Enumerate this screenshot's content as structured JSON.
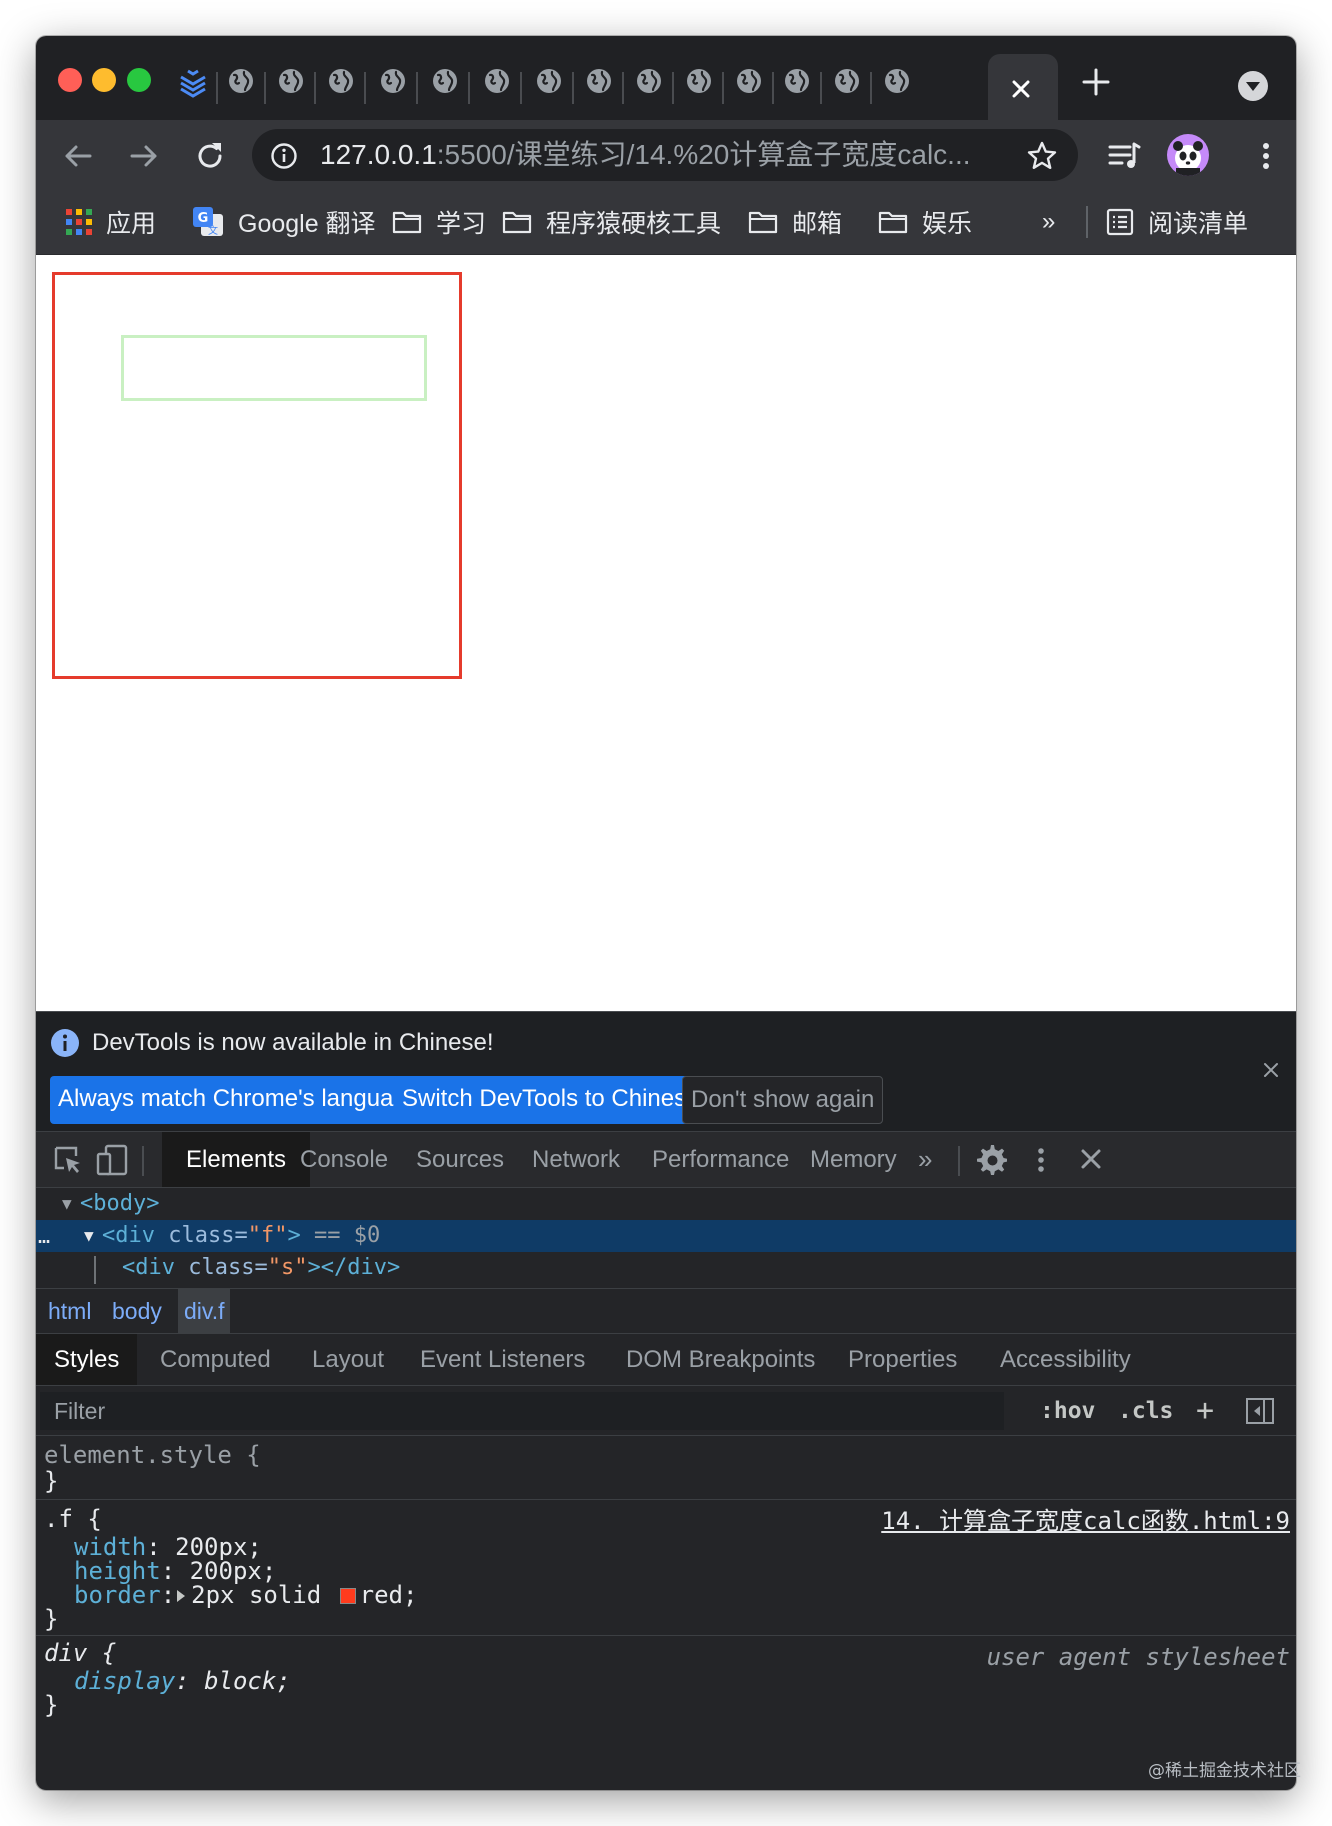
{
  "browser": {
    "active_tab_close_icon": "close-icon",
    "new_tab_icon": "plus-icon",
    "tab_search_icon": "chevron-down-circle-icon",
    "tab_favicon": "globe-icon",
    "first_tab_favicon": "layered-chevrons-icon",
    "url_host": "127.0.0.1",
    "url_path": ":5500/课堂练习/14.%20计算盒子宽度calc...",
    "nav": {
      "back_icon": "arrow-left-icon",
      "forward_icon": "arrow-right-icon",
      "reload_icon": "reload-icon",
      "site_info_icon": "info-circle-icon",
      "bookmark_icon": "star-icon",
      "reading_list_icon": "media-queue-icon",
      "profile_icon": "panda-avatar",
      "menu_icon": "kebab-menu-icon"
    },
    "bookmarks": [
      {
        "label": "应用",
        "icon": "apps-grid-icon"
      },
      {
        "label": "Google 翻译",
        "icon": "google-translate-icon"
      },
      {
        "label": "学习",
        "icon": "folder-icon"
      },
      {
        "label": "程序猿硬核工具",
        "icon": "folder-icon"
      },
      {
        "label": "邮箱",
        "icon": "folder-icon"
      },
      {
        "label": "娱乐",
        "icon": "folder-icon"
      }
    ],
    "bookmarks_overflow": "»",
    "reading_list_label": "阅读清单",
    "traffic_lights": {
      "close": "#ff5f57",
      "minimize": "#febc2e",
      "zoom": "#28c840"
    }
  },
  "page": {
    "outer_box_color": "#e53b2c",
    "inner_box_color": "#c9f0c2"
  },
  "devtools": {
    "infobar": {
      "message": "DevTools is now available in Chinese!",
      "btn_match": "Always match Chrome's language",
      "btn_switch": "Switch DevTools to Chinese",
      "btn_dismiss": "Don't show again"
    },
    "tabs": [
      "Elements",
      "Console",
      "Sources",
      "Network",
      "Performance",
      "Memory"
    ],
    "tabs_overflow": "»",
    "dom": {
      "body_open": "<body>",
      "div_open_tag": "<div",
      "div_attr": "class",
      "div_val": "\"f\"",
      "div_close_bracket": ">",
      "selected_marker": "== $0",
      "child_open": "<div",
      "child_attr": "class",
      "child_val": "\"s\"",
      "child_close": "></div>",
      "ellipsis": "…"
    },
    "breadcrumbs": [
      "html",
      "body",
      "div.f"
    ],
    "subtabs": [
      "Styles",
      "Computed",
      "Layout",
      "Event Listeners",
      "DOM Breakpoints",
      "Properties",
      "Accessibility"
    ],
    "filter": {
      "placeholder": "Filter",
      "hov": ":hov",
      "cls": ".cls",
      "plus": "+"
    },
    "styles": {
      "element_style": "element.style {",
      "close_brace": "}",
      "rule_f": {
        "selector": ".f {",
        "source": "14. 计算盒子宽度calc函数.html:9",
        "decls": [
          {
            "prop": "width",
            "value": "200px;"
          },
          {
            "prop": "height",
            "value": "200px;"
          },
          {
            "prop": "border",
            "value_before": "2px solid",
            "value_after": "red;",
            "swatch": "#ff3b1d"
          }
        ]
      },
      "rule_div": {
        "selector": "div {",
        "source": "user agent stylesheet",
        "decls": [
          {
            "prop": "display",
            "value": "block;"
          }
        ]
      }
    }
  },
  "watermark": "@稀土掘金技术社区"
}
